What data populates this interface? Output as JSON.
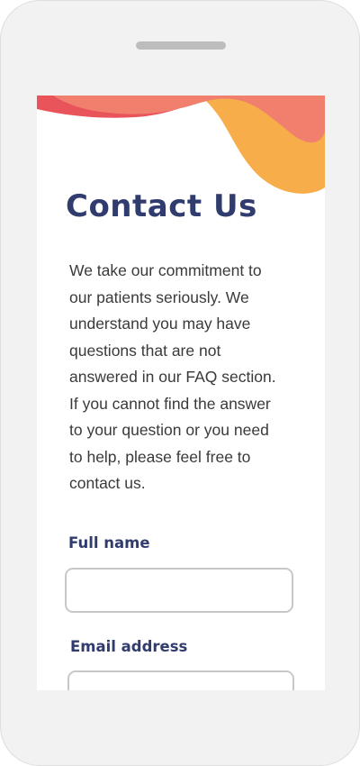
{
  "colors": {
    "heading": "#313c6e",
    "body_text": "#3a3a3a",
    "wave_red": "#e8545a",
    "wave_coral": "#f07f6e",
    "wave_orange": "#f7ad49",
    "input_border": "#c8c8c8",
    "frame": "#f2f2f2"
  },
  "page": {
    "title": "Contact Us",
    "intro": "We take our commitment to\nour patients seriously.  We\nunderstand you may have\nquestions that are not\nanswered in our FAQ section.\nIf you cannot find the answer\nto your question or you need\nto help, please feel free to\ncontact us."
  },
  "form": {
    "full_name": {
      "label": "Full name",
      "value": "",
      "placeholder": ""
    },
    "email": {
      "label": "Email address",
      "value": "",
      "placeholder": ""
    }
  }
}
